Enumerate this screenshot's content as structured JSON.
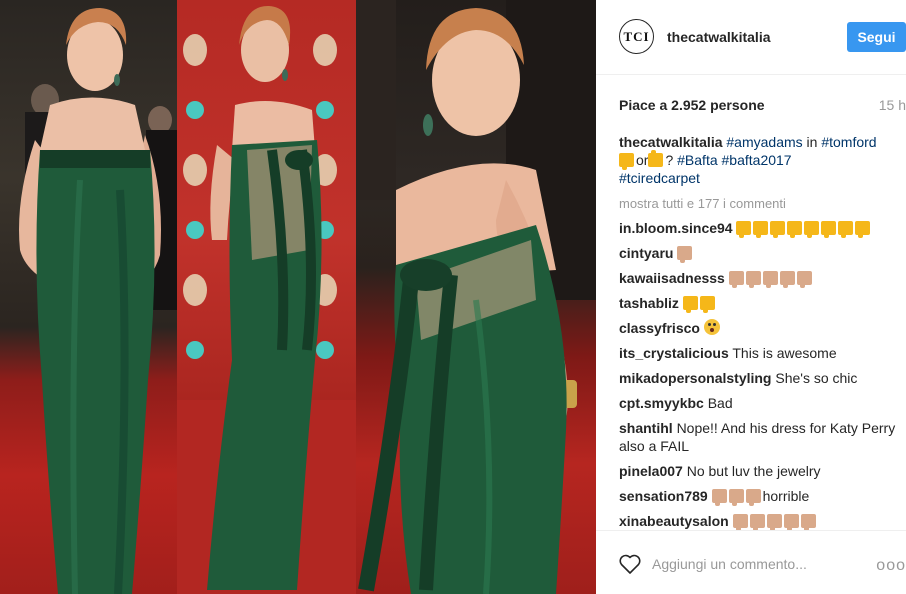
{
  "post": {
    "avatar_text": "TCI",
    "username": "thecatwalkitalia",
    "follow_label": "Segui",
    "likes": "Piace a 2.952 persone",
    "time": "15 h"
  },
  "caption": {
    "user": "thecatwalkitalia",
    "tag1": "#amyadams",
    "in": "in",
    "tag2": "#tomford",
    "or": "or",
    "q": "?",
    "tag3": "#Bafta",
    "tag4": "#bafta2017",
    "tag5": "#tciredcarpet"
  },
  "more_comments": "mostra tutti e 177 i commenti",
  "comments": [
    {
      "user": "in.bloom.since94",
      "text": ""
    },
    {
      "user": "cintyaru",
      "text": ""
    },
    {
      "user": "kawaiisadnesss",
      "text": ""
    },
    {
      "user": "tashabliz",
      "text": ""
    },
    {
      "user": "classyfrisco",
      "text": ""
    },
    {
      "user": "its_crystalicious",
      "text": "This is awesome"
    },
    {
      "user": "mikadopersonalstyling",
      "text": "She's so chic"
    },
    {
      "user": "cpt.smyykbc",
      "text": "Bad"
    },
    {
      "user": "shantihl",
      "text": "Nope!! And his dress for Katy Perry also a FAIL"
    },
    {
      "user": "pinela007",
      "text": "No but luv the jewelry"
    },
    {
      "user": "sensation789",
      "text": "horrible"
    },
    {
      "user": "xinabeautysalon",
      "text": ""
    }
  ],
  "footer": {
    "comment_placeholder": "Aggiungi un commento...",
    "more_dots": "ooo"
  },
  "icons": {
    "like": "heart-icon",
    "options": "more-options-icon",
    "thumbs_down": "thumbs-down-emoji",
    "thumbs_up": "thumbs-up-emoji"
  },
  "colors": {
    "follow_button": "#3897f0",
    "hashtag": "#003569",
    "muted": "#999999",
    "dress_green": "#1f5a3a",
    "carpet_red": "#b52520"
  }
}
